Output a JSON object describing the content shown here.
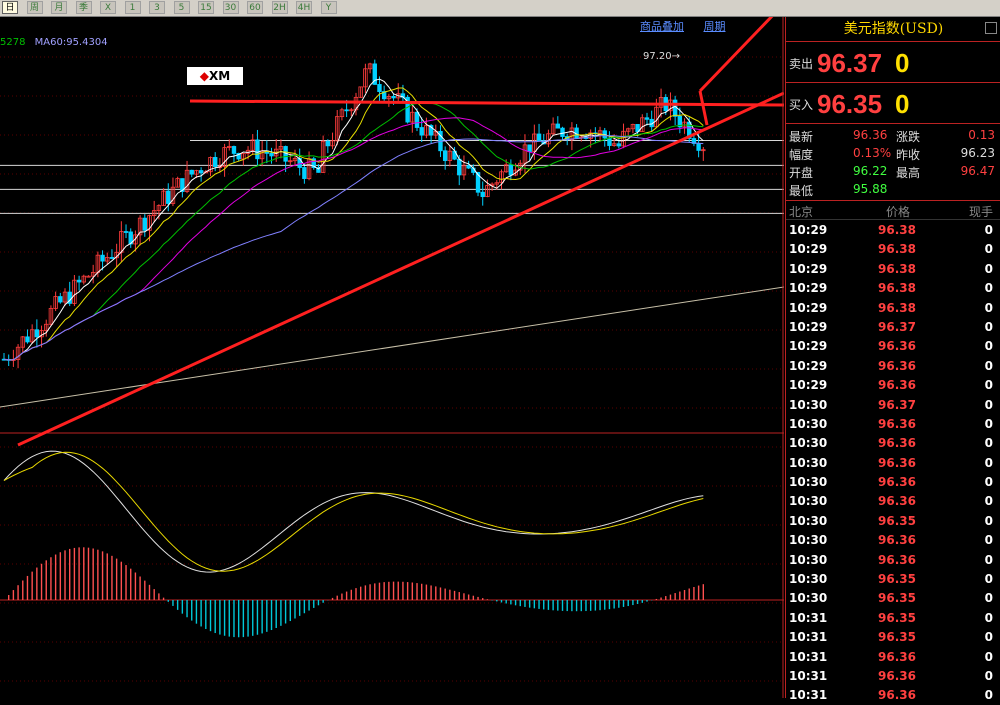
{
  "toolbar": {
    "buttons": [
      "日",
      "周",
      "月",
      "季",
      "X",
      "1",
      "3",
      "5",
      "15",
      "30",
      "60",
      "2H",
      "4H",
      "Y"
    ],
    "active_index": 0
  },
  "chart_links": {
    "overlay": "商品叠加",
    "period": "周期"
  },
  "ma_legend": [
    {
      "text": "5278",
      "color": "#00c000"
    },
    {
      "text": "MA60:95.4304",
      "color": "#a0a0ff"
    }
  ],
  "chart_annotations": {
    "peak_label": "97.20→",
    "logo": "XM"
  },
  "chart_data": {
    "type": "candlestick",
    "ylim": [
      93.2,
      97.6
    ],
    "horizontal_levels": [
      96.37,
      96.1,
      95.84,
      95.58
    ],
    "peak": 97.2,
    "macd_zero": 0,
    "colors": {
      "up": "#ff3c3c",
      "down": "#00d0ff",
      "ma5": "#ffffff",
      "ma10": "#e8e000",
      "ma20": "#00c000",
      "ma30": "#e000e0",
      "ma60": "#8080ff",
      "trend": "#ff2020"
    }
  },
  "panel": {
    "title": "美元指数(USD)",
    "sell_label": "卖出",
    "sell_price": "96.37",
    "sell_vol": "0",
    "buy_label": "买入",
    "buy_price": "96.35",
    "buy_vol": "0",
    "stats": {
      "latest_label": "最新",
      "latest": "96.36",
      "change_label": "涨跌",
      "change": "0.13",
      "range_label": "幅度",
      "range": "0.13%",
      "prevclose_label": "昨收",
      "prevclose": "96.23",
      "open_label": "开盘",
      "open": "96.22",
      "high_label": "最高",
      "high": "96.47",
      "low_label": "最低",
      "low": "95.88"
    },
    "tick_headers": {
      "time": "北京",
      "price": "价格",
      "vol": "现手"
    },
    "ticks": [
      {
        "time": "10:29",
        "price": "96.38",
        "vol": "0"
      },
      {
        "time": "10:29",
        "price": "96.38",
        "vol": "0"
      },
      {
        "time": "10:29",
        "price": "96.38",
        "vol": "0"
      },
      {
        "time": "10:29",
        "price": "96.38",
        "vol": "0"
      },
      {
        "time": "10:29",
        "price": "96.38",
        "vol": "0"
      },
      {
        "time": "10:29",
        "price": "96.37",
        "vol": "0"
      },
      {
        "time": "10:29",
        "price": "96.36",
        "vol": "0"
      },
      {
        "time": "10:29",
        "price": "96.36",
        "vol": "0"
      },
      {
        "time": "10:29",
        "price": "96.36",
        "vol": "0"
      },
      {
        "time": "10:30",
        "price": "96.37",
        "vol": "0"
      },
      {
        "time": "10:30",
        "price": "96.36",
        "vol": "0"
      },
      {
        "time": "10:30",
        "price": "96.36",
        "vol": "0"
      },
      {
        "time": "10:30",
        "price": "96.36",
        "vol": "0"
      },
      {
        "time": "10:30",
        "price": "96.36",
        "vol": "0"
      },
      {
        "time": "10:30",
        "price": "96.36",
        "vol": "0"
      },
      {
        "time": "10:30",
        "price": "96.35",
        "vol": "0"
      },
      {
        "time": "10:30",
        "price": "96.36",
        "vol": "0"
      },
      {
        "time": "10:30",
        "price": "96.36",
        "vol": "0"
      },
      {
        "time": "10:30",
        "price": "96.35",
        "vol": "0"
      },
      {
        "time": "10:30",
        "price": "96.35",
        "vol": "0"
      },
      {
        "time": "10:31",
        "price": "96.35",
        "vol": "0"
      },
      {
        "time": "10:31",
        "price": "96.35",
        "vol": "0"
      },
      {
        "time": "10:31",
        "price": "96.36",
        "vol": "0"
      },
      {
        "time": "10:31",
        "price": "96.36",
        "vol": "0"
      },
      {
        "time": "10:31",
        "price": "96.36",
        "vol": "0"
      }
    ]
  }
}
